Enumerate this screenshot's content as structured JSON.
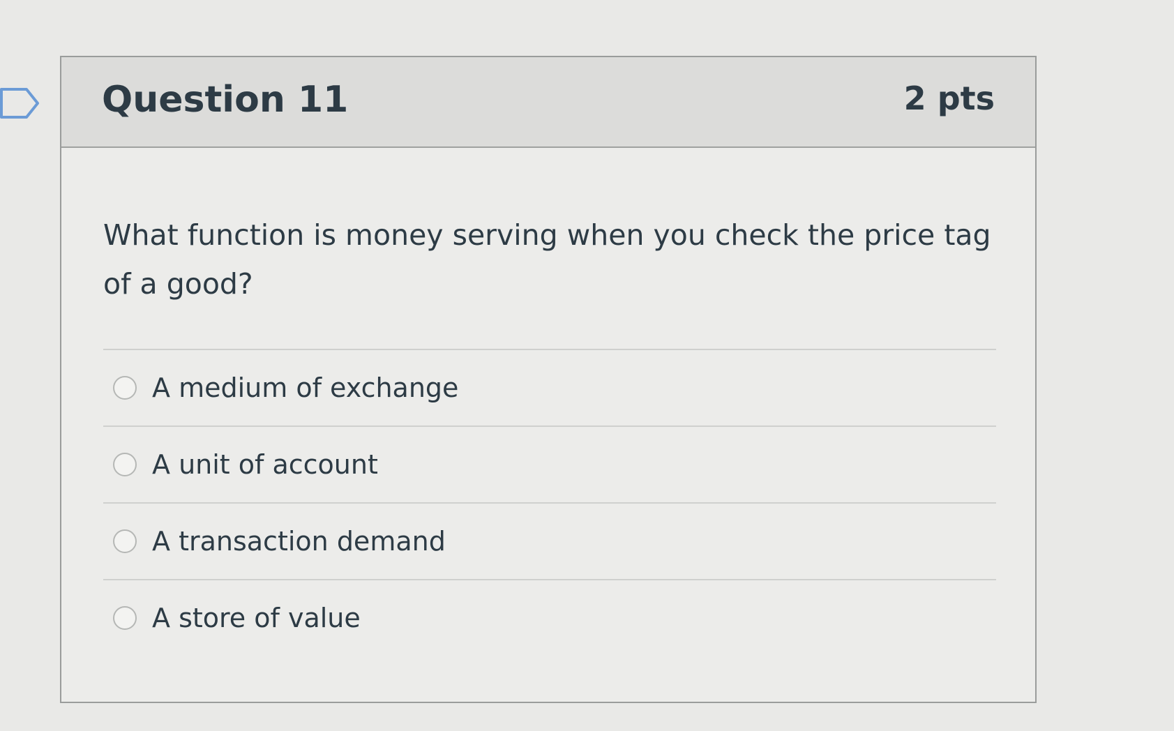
{
  "question": {
    "title": "Question 11",
    "points": "2 pts",
    "text": "What function is money serving when you check the price tag of a good?",
    "flag_icon": "bookmark-flag-icon"
  },
  "answers": [
    {
      "label": "A medium of exchange",
      "selected": false
    },
    {
      "label": "A unit of account",
      "selected": false
    },
    {
      "label": "A transaction demand",
      "selected": false
    },
    {
      "label": "A store of value",
      "selected": false
    }
  ],
  "colors": {
    "text": "#2d3b45",
    "header_bg": "#dcdcda",
    "body_bg": "#ececea",
    "border": "#9a9c9b"
  }
}
